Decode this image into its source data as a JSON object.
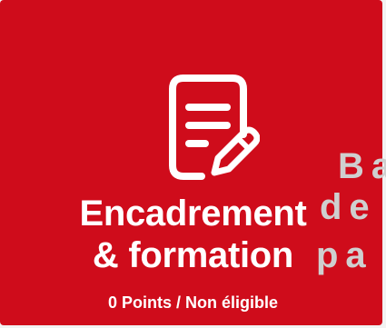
{
  "card": {
    "title_line1": "Encadrement",
    "title_line2": "& formation",
    "subtitle": "0 Points / Non éligible",
    "icon": "document-edit-icon"
  },
  "overlay": {
    "lines": [
      "Ba",
      "de",
      "pa"
    ]
  },
  "colors": {
    "card_background": "#cf0c1b",
    "card_text": "#ffffff",
    "overlay_text": "#cfcfcf",
    "page_background": "#f2f2f2"
  }
}
